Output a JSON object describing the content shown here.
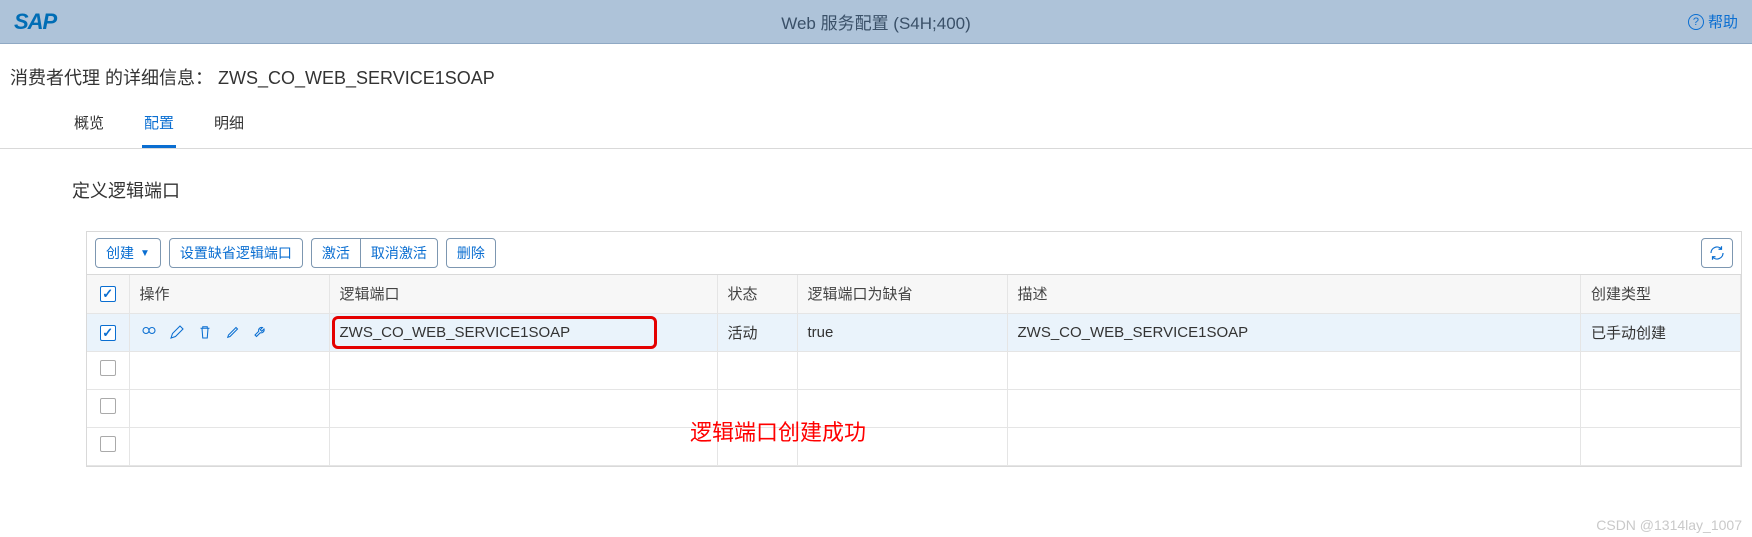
{
  "header": {
    "logo_text": "SAP",
    "title": "Web 服务配置 (S4H;400)",
    "help_label": "帮助"
  },
  "detail": {
    "prefix": "消费者代理 的详细信息：",
    "name": "ZWS_CO_WEB_SERVICE1SOAP"
  },
  "tabs": [
    {
      "label": "概览",
      "active": false
    },
    {
      "label": "配置",
      "active": true
    },
    {
      "label": "明细",
      "active": false
    }
  ],
  "section": {
    "title": "定义逻辑端口"
  },
  "toolbar": {
    "create_label": "创建",
    "set_default_label": "设置缺省逻辑端口",
    "activate_label": "激活",
    "deactivate_label": "取消激活",
    "delete_label": "删除"
  },
  "columns": {
    "actions": "操作",
    "logical_port": "逻辑端口",
    "status": "状态",
    "is_default": "逻辑端口为缺省",
    "description": "描述",
    "creation_type": "创建类型"
  },
  "rows": [
    {
      "checked": true,
      "logical_port": "ZWS_CO_WEB_SERVICE1SOAP",
      "status": "活动",
      "is_default": "true",
      "description": "ZWS_CO_WEB_SERVICE1SOAP",
      "creation_type": "已手动创建"
    },
    {
      "checked": false,
      "logical_port": "",
      "status": "",
      "is_default": "",
      "description": "",
      "creation_type": ""
    },
    {
      "checked": false,
      "logical_port": "",
      "status": "",
      "is_default": "",
      "description": "",
      "creation_type": ""
    },
    {
      "checked": false,
      "logical_port": "",
      "status": "",
      "is_default": "",
      "description": "",
      "creation_type": ""
    }
  ],
  "annotation": "逻辑端口创建成功",
  "watermark": "CSDN @1314lay_1007"
}
